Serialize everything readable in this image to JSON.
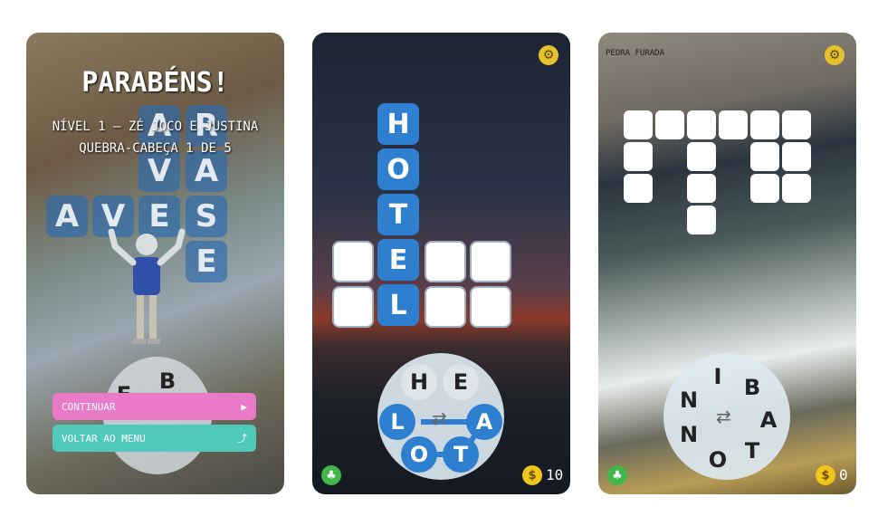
{
  "screen1": {
    "title": "PARABÉNS!",
    "level_line": "NÍVEL 1 – ZÉ JOCO E JUSTINA",
    "puzzle_line": "QUEBRA-CABEÇA 1 DE 5",
    "ghost_letters": [
      "A",
      "R",
      "V",
      "A",
      "A",
      "V",
      "E",
      "S",
      "E"
    ],
    "wheel_letters": [
      "B",
      "E"
    ],
    "continue_label": "CONTINUAR",
    "menu_label": "VOLTAR AO MENU"
  },
  "screen2": {
    "vertical_word": [
      "H",
      "O",
      "T",
      "E",
      "L"
    ],
    "wheel_letters": [
      "H",
      "E",
      "L",
      "A",
      "O",
      "T"
    ],
    "coins": "10"
  },
  "screen3": {
    "location_label": "PEDRA FURADA",
    "wheel_letters": [
      "I",
      "B",
      "N",
      "A",
      "N",
      "T",
      "O"
    ],
    "coins": "0"
  }
}
